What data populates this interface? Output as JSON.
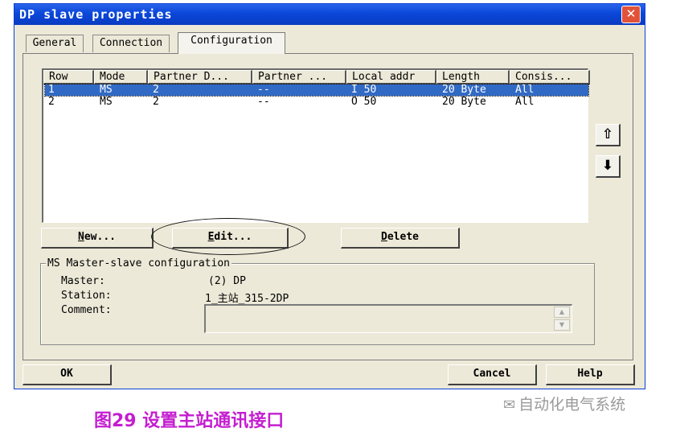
{
  "window": {
    "title": "DP slave properties",
    "close_glyph": "✕"
  },
  "tabs": [
    {
      "label": "General"
    },
    {
      "label": "Connection"
    },
    {
      "label": "Configuration",
      "active": true
    }
  ],
  "table": {
    "columns": [
      "Row",
      "Mode",
      "Partner D...",
      "Partner ...",
      "Local addr",
      "Length",
      "Consis..."
    ],
    "rows": [
      {
        "selected": true,
        "cells": [
          "1",
          "MS",
          "2",
          "--",
          "I 50",
          "20 Byte",
          "All"
        ]
      },
      {
        "selected": false,
        "cells": [
          "2",
          "MS",
          "2",
          "--",
          "O 50",
          "20 Byte",
          "All"
        ]
      }
    ]
  },
  "arrows": {
    "up_icon": "move-up-icon",
    "up_glyph": "⇧",
    "down_icon": "move-down-icon",
    "down_glyph": "⬇"
  },
  "buttons": {
    "new_mnemonic": "N",
    "new_rest": "ew...",
    "edit_mnemonic": "E",
    "edit_rest": "dit...",
    "delete_mnemonic": "D",
    "delete_rest": "elete",
    "ok": "OK",
    "cancel": "Cancel",
    "help": "Help"
  },
  "ms_config": {
    "legend": "MS Master-slave configuration",
    "master_label": "Master:",
    "master_value": "(2) DP",
    "station_label": "Station:",
    "station_value": "1_主站_315-2DP",
    "comment_label": "Comment:",
    "comment_value": ""
  },
  "caption": "图29  设置主站通讯接口",
  "watermark": "自动化电气系统",
  "colors": {
    "title_bar": "#0a47d9",
    "selection": "#316ac5",
    "caption": "#c41ed0",
    "dialog_bg": "#ece9d8"
  }
}
